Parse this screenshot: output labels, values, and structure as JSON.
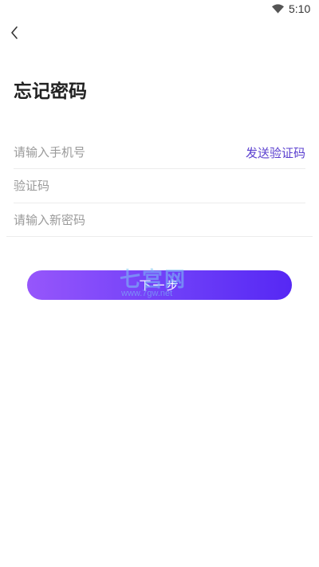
{
  "status_bar": {
    "time": "5:10",
    "wifi_icon": "wifi-icon"
  },
  "header": {
    "back_icon": "chevron-left-icon",
    "title": "忘记密码"
  },
  "form": {
    "phone": {
      "placeholder": "请输入手机号",
      "value": ""
    },
    "send_code_label": "发送验证码",
    "code": {
      "placeholder": "验证码",
      "value": ""
    },
    "new_password": {
      "placeholder": "请输入新密码",
      "value": ""
    },
    "next_label": "下一步"
  },
  "watermark": {
    "main": "七宫网",
    "sub": "www.7gw.net"
  },
  "colors": {
    "accent": "#5a3fcf",
    "button_gradient_start": "#9656fb",
    "button_gradient_end": "#5628f4",
    "placeholder": "#9a9a9a",
    "divider": "#ececec"
  }
}
